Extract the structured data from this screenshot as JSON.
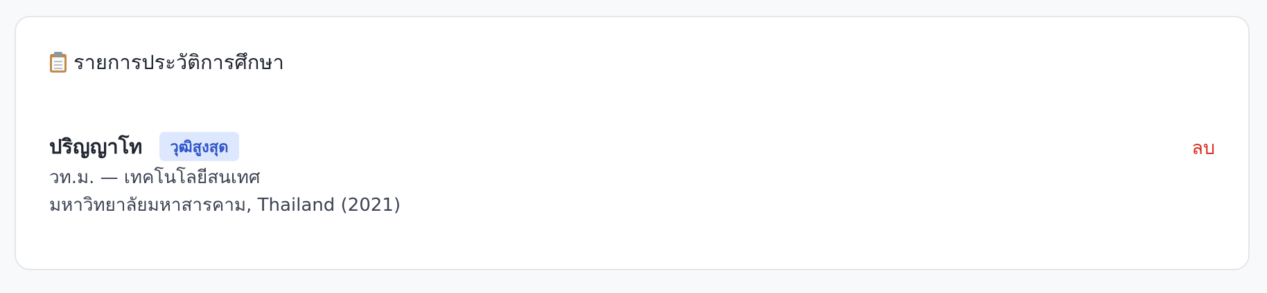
{
  "section": {
    "icon": "clipboard-icon",
    "title": "รายการประวัติการศึกษา"
  },
  "entry": {
    "degree": "ปริญญาโท",
    "badge": "วุฒิสูงสุด",
    "field_line": "วท.ม. — เทคโนโลยีสนเทศ",
    "institution_line": "มหาวิทยาลัยมหาสารคาม, Thailand (2021)",
    "delete_label": "ลบ"
  },
  "colors": {
    "badge_bg": "#dde8ff",
    "badge_text": "#2f55c7",
    "delete": "#d93025"
  }
}
